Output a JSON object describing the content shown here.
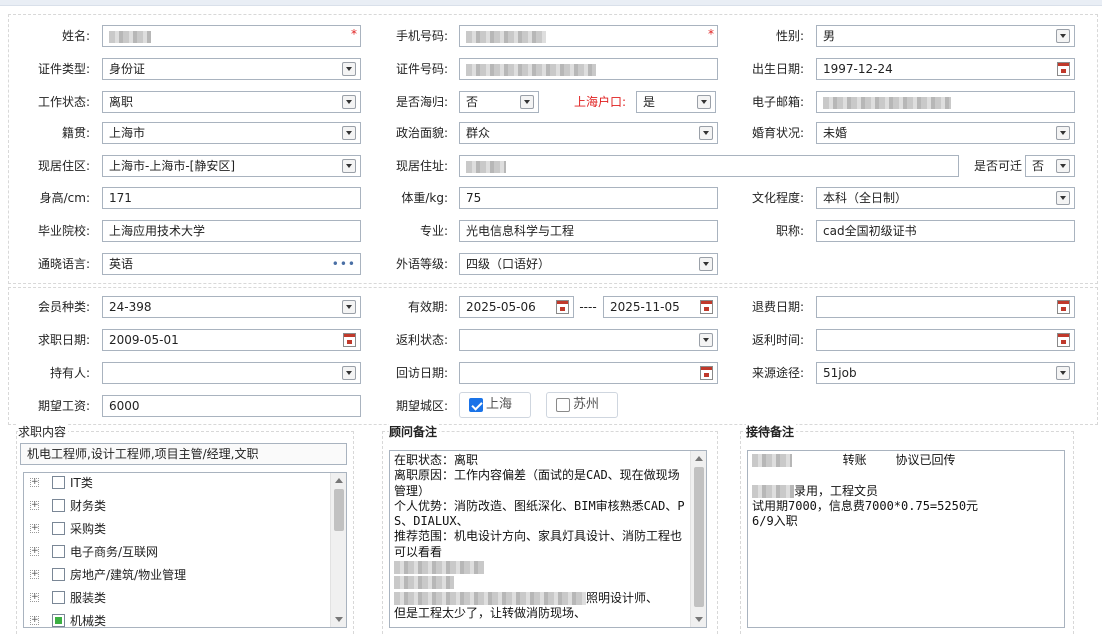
{
  "personal": {
    "name": {
      "label": "姓名:",
      "value": ""
    },
    "phone": {
      "label": "手机号码:",
      "value": ""
    },
    "gender": {
      "label": "性别:",
      "value": "男"
    },
    "id_type": {
      "label": "证件类型:",
      "value": "身份证"
    },
    "id_number": {
      "label": "证件号码:",
      "value": ""
    },
    "birth_date": {
      "label": "出生日期:",
      "value": "1997-12-24"
    },
    "work_status": {
      "label": "工作状态:",
      "value": "离职"
    },
    "overseas_return": {
      "label": "是否海归:",
      "value": "否"
    },
    "shanghai_hukou": {
      "label": "上海户口:",
      "value": "是"
    },
    "email": {
      "label": "电子邮箱:",
      "value": ""
    },
    "native_place": {
      "label": "籍贯:",
      "value": "上海市"
    },
    "political_status": {
      "label": "政治面貌:",
      "value": "群众"
    },
    "marital_status": {
      "label": "婚育状况:",
      "value": "未婚"
    },
    "current_area": {
      "label": "现居住区:",
      "value": "上海市-上海市-[静安区]"
    },
    "current_address": {
      "label": "现居住址:",
      "value": ""
    },
    "relocatable": {
      "label": "是否可迁",
      "value": "否"
    },
    "height": {
      "label": "身高/cm:",
      "value": "171"
    },
    "weight": {
      "label": "体重/kg:",
      "value": "75"
    },
    "education": {
      "label": "文化程度:",
      "value": "本科（全日制）"
    },
    "school": {
      "label": "毕业院校:",
      "value": "上海应用技术大学"
    },
    "major": {
      "label": "专业:",
      "value": "光电信息科学与工程"
    },
    "title": {
      "label": "职称:",
      "value": "cad全国初级证书"
    },
    "languages": {
      "label": "通晓语言:",
      "value": "英语",
      "more": "•••"
    },
    "foreign_level": {
      "label": "外语等级:",
      "value": "四级（口语好）"
    }
  },
  "membership": {
    "member_type": {
      "label": "会员种类:",
      "value": "24-398"
    },
    "valid_period": {
      "label": "有效期:",
      "start": "2025-05-06",
      "separator": "----",
      "end": "2025-11-05"
    },
    "refund_date": {
      "label": "退费日期:",
      "value": ""
    },
    "job_seek_date": {
      "label": "求职日期:",
      "value": "2009-05-01"
    },
    "rebate_status": {
      "label": "返利状态:",
      "value": ""
    },
    "rebate_time": {
      "label": "返利时间:",
      "value": ""
    },
    "holder": {
      "label": "持有人:",
      "value": ""
    },
    "visit_date": {
      "label": "回访日期:",
      "value": ""
    },
    "source": {
      "label": "来源途径:",
      "value": "51job"
    },
    "expected_salary": {
      "label": "期望工资:",
      "value": "6000"
    },
    "expected_city": {
      "label": "期望城区:",
      "options": [
        {
          "label": "上海",
          "checked": true
        },
        {
          "label": "苏州",
          "checked": false
        }
      ]
    }
  },
  "job_content": {
    "title": "求职内容",
    "selected": "机电工程师,设计工程师,项目主管/经理,文职",
    "tree": [
      {
        "label": "IT类",
        "partial": false
      },
      {
        "label": "财务类",
        "partial": false
      },
      {
        "label": "采购类",
        "partial": false
      },
      {
        "label": "电子商务/互联网",
        "partial": false
      },
      {
        "label": "房地产/建筑/物业管理",
        "partial": false
      },
      {
        "label": "服装类",
        "partial": false
      },
      {
        "label": "机械类",
        "partial": true
      }
    ]
  },
  "advisor_notes": {
    "title": "顾问备注",
    "lines": [
      "在职状态：离职",
      "离职原因：工作内容偏差（面试的是CAD、现在做现场管理）",
      "个人优势：消防改造、图纸深化、BIM审核熟悉CAD、PS、DIALUX、",
      "推荐范围：机电设计方向、家具灯具设计、消防工程也可以看看",
      "",
      "照明设计师、",
      "但是工程太少了，让转做消防现场、"
    ]
  },
  "reception_notes": {
    "title": "接待备注",
    "line1_a": "转账",
    "line1_b": "协议已回传",
    "line2_suffix": "录用，工程文员",
    "line3": "试用期7000，信息费7000*0.75=5250元",
    "line4": "6/9入职"
  }
}
